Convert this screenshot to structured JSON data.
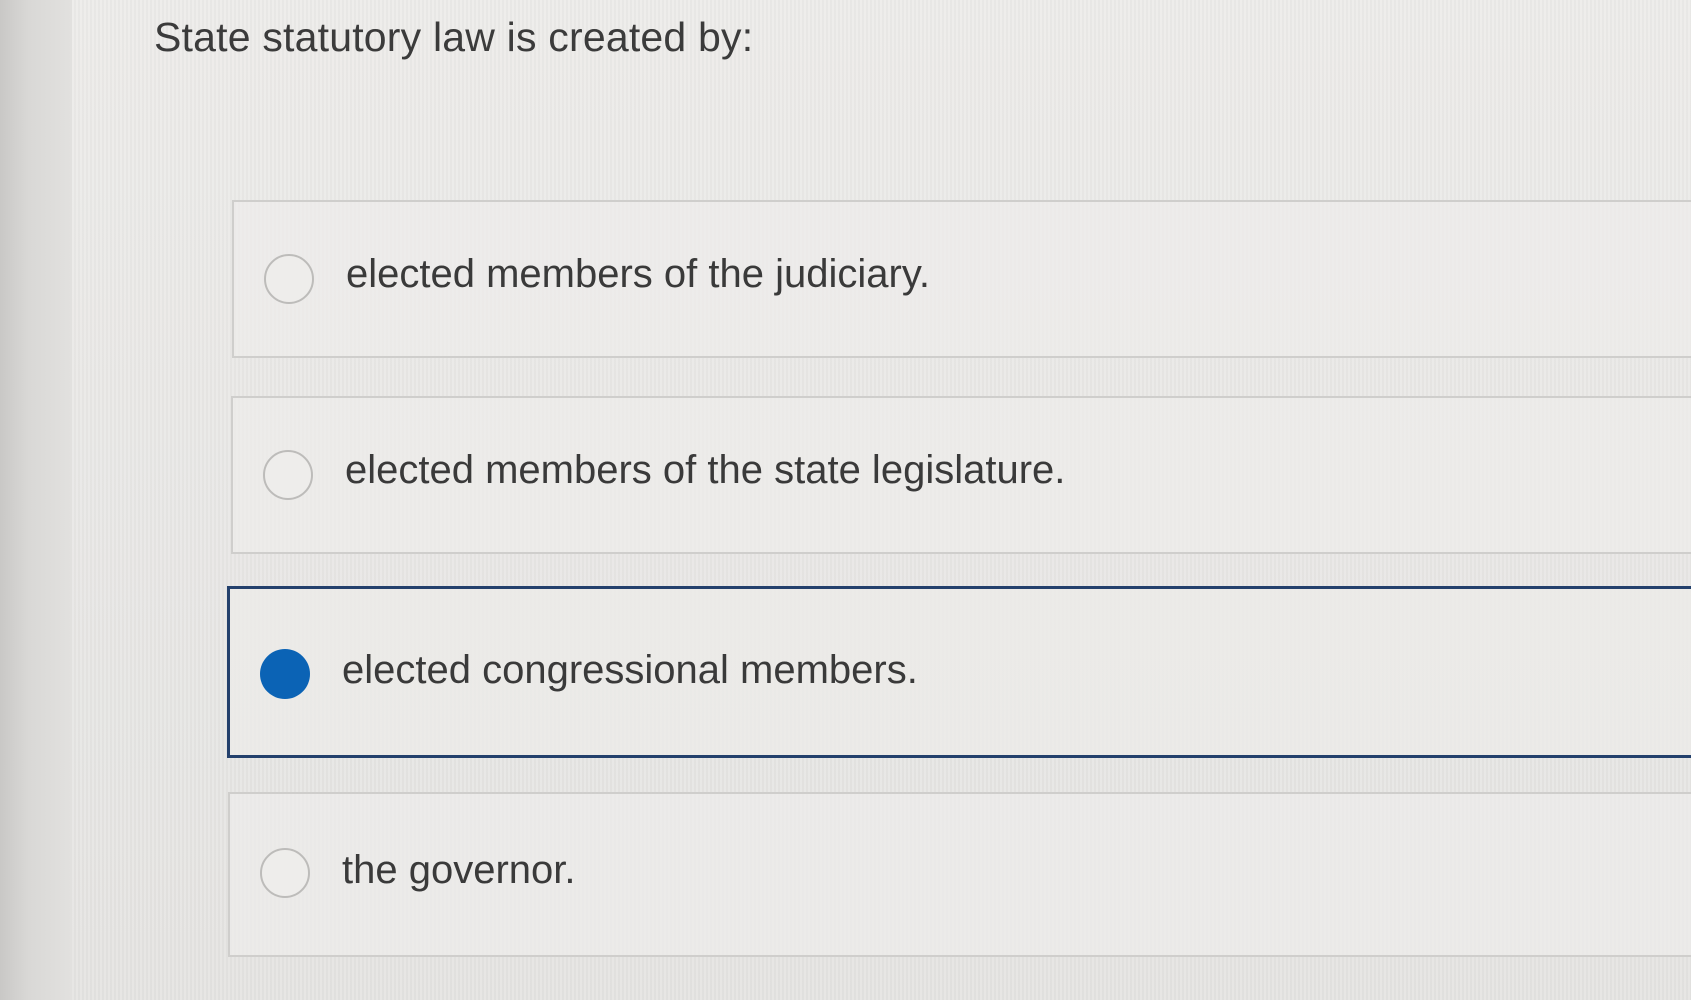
{
  "question": {
    "text": "State statutory law is created by:"
  },
  "options": [
    {
      "label": "elected members of the judiciary.",
      "selected": false
    },
    {
      "label": "elected members of the state legislature.",
      "selected": false
    },
    {
      "label": "elected congressional members.",
      "selected": true
    },
    {
      "label": "the governor.",
      "selected": false
    }
  ],
  "colors": {
    "selected_radio": "#0b63b5",
    "selected_border": "#23406c",
    "unselected_border": "#cfcecc"
  }
}
